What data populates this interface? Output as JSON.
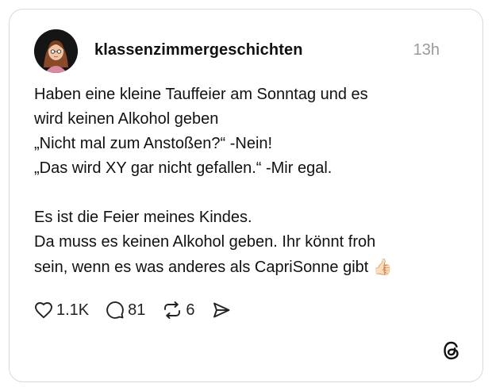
{
  "post": {
    "username": "klassenzimmergeschichten",
    "timestamp": "13h",
    "text": {
      "line1": "Haben eine kleine Tauffeier am Sonntag und es",
      "line2": "wird keinen Alkohol geben",
      "line3": "„Nicht mal zum Anstoßen?“ -Nein!",
      "line4": "„Das wird XY gar nicht gefallen.“ -Mir egal.",
      "line5": "Es ist die Feier meines Kindes.",
      "line6": "Da muss es keinen Alkohol geben. Ihr könnt froh",
      "line7": "sein, wenn es was anderes als CapriSonne gibt",
      "emoji": "👍🏻"
    },
    "actions": {
      "likes": "1.1K",
      "replies": "81",
      "reposts": "6"
    }
  },
  "icons": {
    "avatar": "profile-avatar",
    "like": "heart-icon",
    "reply": "comment-bubble-icon",
    "repost": "repost-arrows-icon",
    "share": "send-arrow-icon",
    "brand": "threads-logo"
  },
  "colors": {
    "border": "#d9d9d9",
    "timestamp": "#9a9a9a",
    "text": "#111111"
  }
}
